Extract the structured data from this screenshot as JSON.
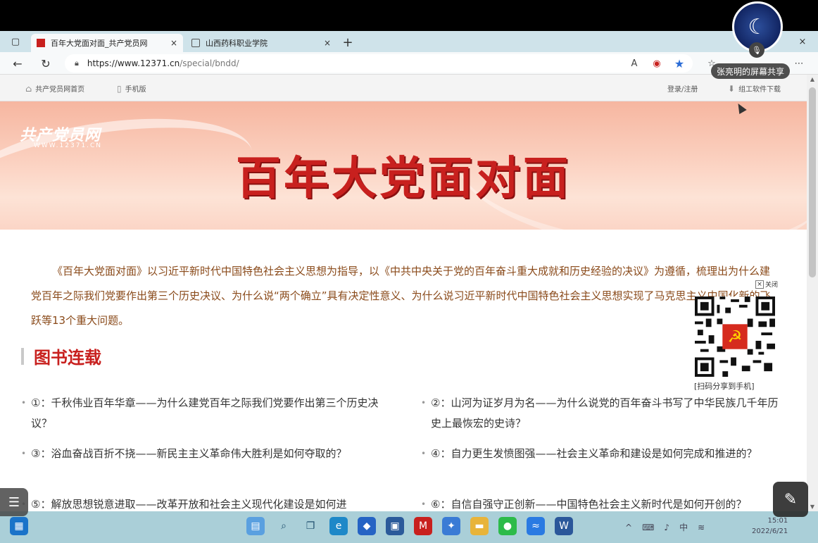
{
  "browser": {
    "tabs": [
      {
        "label": "百年大党面对面_共产党员网",
        "active": true
      },
      {
        "label": "山西药科职业学院",
        "active": false
      }
    ],
    "new_tab": "+",
    "close_glyph": "×",
    "url_host": "https://www.12371.cn",
    "url_path": "/special/bndd/"
  },
  "site": {
    "home_link": "共产党员网首页",
    "mobile_link": "手机版",
    "login_link": "登录/注册",
    "download_link": "组工软件下载"
  },
  "banner": {
    "logo": "共产党员网",
    "logo_url": "WWW.12371.CN",
    "title": "百年大党面对面"
  },
  "intro": "《百年大党面对面》以习近平新时代中国特色社会主义思想为指导，以《中共中央关于党的百年奋斗重大成就和历史经验的决议》为遵循，梳理出为什么建党百年之际我们党要作出第三个历史决议、为什么说“两个确立”具有决定性意义、为什么说习近平新时代中国特色社会主义思想实现了马克思主义中国化新的飞跃等13个重大问题。",
  "section_title": "图书连载",
  "articles": [
    "①：千秋伟业百年华章——为什么建党百年之际我们党要作出第三个历史决议？",
    "②：山河为证岁月为名——为什么说党的百年奋斗书写了中华民族几千年历史上最恢宏的史诗？",
    "③：浴血奋战百折不挠——新民主主义革命伟大胜利是如何夺取的？",
    "④：自力更生发愤图强——社会主义革命和建设是如何完成和推进的？",
    "⑤：解放思想锐意进取——改革开放和社会主义现代化建设是如何进",
    "⑥：自信自强守正创新——中国特色社会主义新时代是如何开创的？"
  ],
  "qr": {
    "close_label": "关闭",
    "caption": "[扫码分享到手机]"
  },
  "meeting": {
    "share_label": "张亮明的屏幕共享"
  },
  "taskbar": {
    "ime": "中",
    "time": "15:01",
    "date": "2022/6/21"
  },
  "colors": {
    "accent_red": "#c8201e",
    "intro_text": "#8a4a1a",
    "taskbar": "#aacfd8"
  }
}
